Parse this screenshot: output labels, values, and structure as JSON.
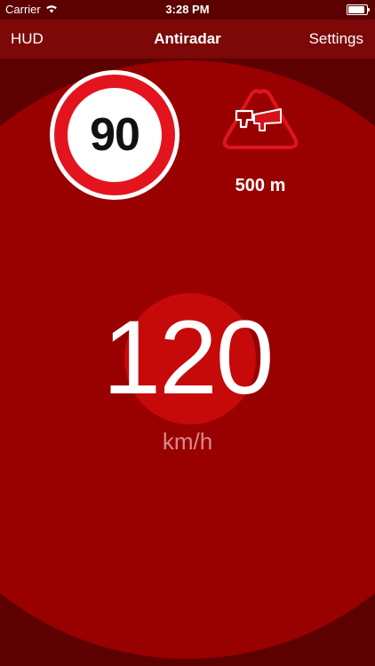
{
  "status_bar": {
    "carrier": "Carrier",
    "time": "3:28 PM",
    "icons": [
      "wifi-icon",
      "battery-icon"
    ]
  },
  "nav": {
    "left_label": "HUD",
    "title": "Antiradar",
    "right_label": "Settings"
  },
  "speed_limit": {
    "value": "90"
  },
  "camera": {
    "icon": "speed-camera-warning-icon",
    "distance": "500 m"
  },
  "speed": {
    "value": "120",
    "unit": "km/h"
  },
  "colors": {
    "background": "#990000",
    "nav_bar": "#7c0808",
    "sign_red": "#e3141d",
    "warning_red": "#e0141e",
    "unit_text": "#d88a8a"
  }
}
